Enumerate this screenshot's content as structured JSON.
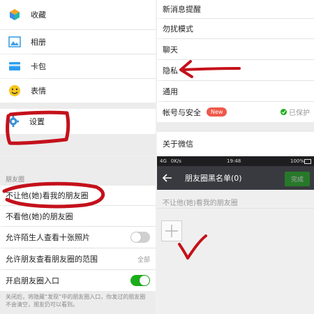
{
  "panel1": {
    "items": [
      {
        "label": "收藏",
        "icon": "favorites-cube-icon"
      },
      {
        "label": "相册",
        "icon": "album-picture-icon"
      },
      {
        "label": "卡包",
        "icon": "card-wallet-icon"
      },
      {
        "label": "表情",
        "icon": "sticker-smiley-icon"
      }
    ],
    "settings_label": "设置",
    "colors": {
      "cube_orange": "#f6a524",
      "cube_teal": "#27b9a7",
      "cube_blue": "#3f8be6",
      "album": "#3aa0e8",
      "card": "#2b9ef0",
      "smiley": "#f7c51d",
      "gear": "#3a92d6"
    }
  },
  "panel2": {
    "items": [
      {
        "label": "新消息提醒"
      },
      {
        "label": "勿扰模式"
      },
      {
        "label": "聊天"
      },
      {
        "label": "隐私"
      },
      {
        "label": "通用"
      }
    ],
    "account_label": "帐号与安全",
    "new_badge": "New",
    "protected_text": "已保护",
    "about_label": "关于微信",
    "badge_color": "#f0584a",
    "protected_color": "#1aad19"
  },
  "panel3": {
    "section_header": "朋友圈",
    "rows": {
      "block_him": "不让他(她)看我的朋友圈",
      "hide_his": "不看他(她)的朋友圈",
      "stranger_photos": "允许陌生人查看十张照片",
      "friend_range": "允许朋友查看朋友圈的范围",
      "friend_range_value": "全部",
      "enable_moments": "开启朋友圈入口"
    },
    "moments_toggle_on": true,
    "stranger_toggle_on": false,
    "note": "关闭后，将隐藏“发现”中的朋友圈入口，你发过的朋友圈不会清空，朋友仍可以看到。",
    "toggle_on_color": "#1aad19"
  },
  "panel4": {
    "status": {
      "signal": "4G",
      "speed": "0K/s",
      "time": "19:48",
      "battery": "100%"
    },
    "title": "朋友圈黑名单(0)",
    "done_label": "完成",
    "subtitle": "不让他(她)看我的朋友圈",
    "done_color": "#1aad19",
    "header_bg": "#393a3f"
  },
  "annotation_color": "#c4111b"
}
